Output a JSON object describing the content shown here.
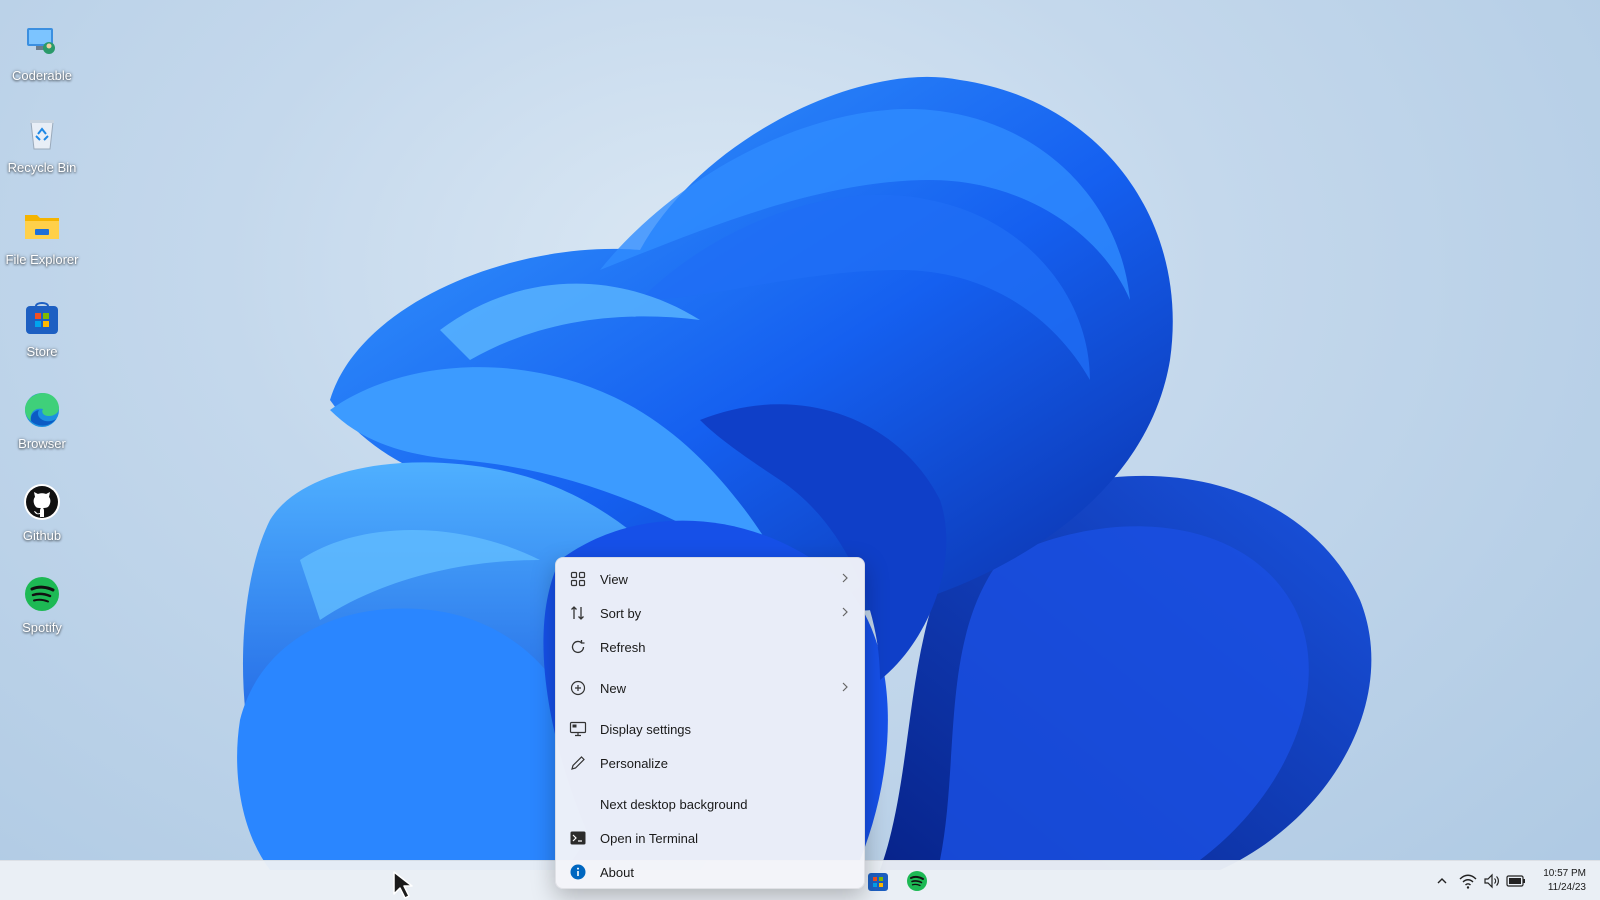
{
  "desktop_icons": [
    {
      "label": "Coderable",
      "icon": "coderable-icon"
    },
    {
      "label": "Recycle Bin",
      "icon": "recycle-bin-icon"
    },
    {
      "label": "File Explorer",
      "icon": "folder-icon"
    },
    {
      "label": "Store",
      "icon": "store-icon"
    },
    {
      "label": "Browser",
      "icon": "edge-browser-icon"
    },
    {
      "label": "Github",
      "icon": "github-icon"
    },
    {
      "label": "Spotify",
      "icon": "spotify-icon"
    }
  ],
  "context_menu": {
    "items": [
      {
        "label": "View",
        "icon": "grid-icon",
        "has_submenu": true
      },
      {
        "label": "Sort by",
        "icon": "sort-icon",
        "has_submenu": true
      },
      {
        "label": "Refresh",
        "icon": "refresh-icon",
        "has_submenu": false
      },
      {
        "label": "New",
        "icon": "plus-circle-icon",
        "has_submenu": true
      },
      {
        "label": "Display settings",
        "icon": "display-icon",
        "has_submenu": false
      },
      {
        "label": "Personalize",
        "icon": "pen-icon",
        "has_submenu": false
      },
      {
        "label": "Next desktop background",
        "icon": "",
        "has_submenu": false
      },
      {
        "label": "Open in Terminal",
        "icon": "terminal-icon",
        "has_submenu": false
      },
      {
        "label": "About",
        "icon": "info-icon",
        "has_submenu": false
      }
    ]
  },
  "taskbar": {
    "pinned": [
      "store-icon",
      "spotify-icon"
    ],
    "tray": [
      "chevron-up-icon",
      "wifi-icon",
      "volume-icon",
      "battery-icon"
    ],
    "time": "10:57 PM",
    "date": "11/24/23"
  },
  "colors": {
    "accent": "#0067c0",
    "menu_bg": "#f2f4f9",
    "spotify_green": "#1db954"
  }
}
